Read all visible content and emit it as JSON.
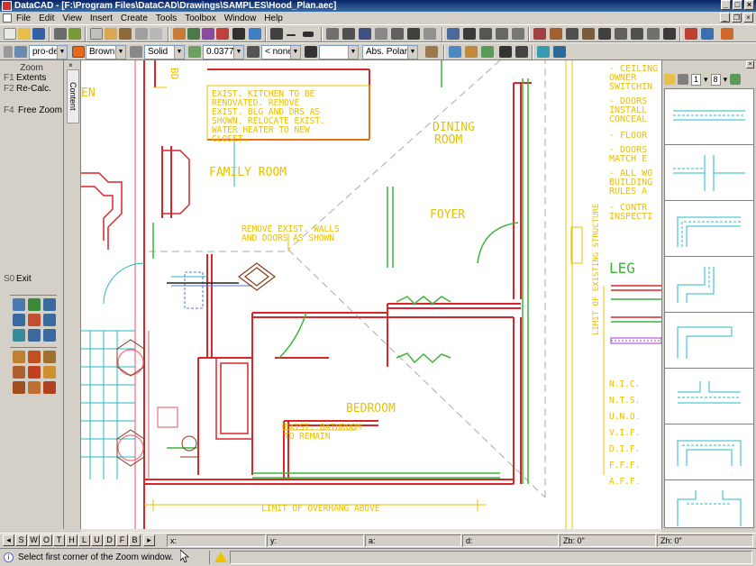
{
  "window": {
    "title": "DataCAD - [F:\\Program Files\\DataCAD\\Drawings\\SAMPLES\\Hood_Plan.aec]"
  },
  "menu": [
    "File",
    "Edit",
    "View",
    "Insert",
    "Create",
    "Tools",
    "Toolbox",
    "Window",
    "Help"
  ],
  "toolbar2": {
    "layer": "pro-dek",
    "color": "Brown",
    "linetype": "Solid",
    "line_weight": "0.037772",
    "none_combo": "< none >",
    "angle_mode": "Abs. Polar"
  },
  "left_menu": {
    "title": "Zoom",
    "items": [
      {
        "key": "F1",
        "label": "Extents"
      },
      {
        "key": "F2",
        "label": "Re-Calc."
      },
      {
        "key": "F4",
        "label": "Free Zoom"
      }
    ],
    "exit": {
      "key": "S0",
      "label": "Exit"
    }
  },
  "side_tab": {
    "label": "Content"
  },
  "drawing": {
    "notes": {
      "kitchen": [
        "EXIST. KITCHEN TO BE",
        "RENOVATED.  REMOVE",
        "EXIST. BLG AND DRS AS",
        "SHOWN.  RELOCATE EXIST.",
        "WATER HEATER TO NEW",
        "CLOSET."
      ],
      "walls": [
        "REMOVE EXIST. WALLS",
        "AND DOORS AS SHOWN"
      ],
      "bath": [
        "EXIST. BATHROOM",
        "TO REMAIN"
      ],
      "overhang": "LIMIT OF OVERHANG ABOVE",
      "structure": "LIMIT OF EXISTING STRUCTURE",
      "right_notes": [
        "- CEILING",
        "OWNER",
        "SWITCHIN",
        "- DOORS",
        "INSTALL",
        "CONCEAL",
        "- FLOOR",
        "- DOORS",
        "MATCH E",
        "- ALL WO",
        "BUILDING",
        "RULES A",
        "- CONTR",
        "INSPECTI"
      ],
      "legend": "LEG",
      "abbrev": [
        "N.I.C.",
        "N.T.S.",
        "U.N.O.",
        "V.I.F.",
        "D.I.F.",
        "F.F.F.",
        "A.F.F."
      ]
    },
    "rooms": {
      "family": "FAMILY ROOM",
      "dining": [
        "DINING",
        "ROOM"
      ],
      "foyer": "FOYER",
      "bedroom": "BEDROOM",
      "partial": "EN"
    }
  },
  "right_panel": {
    "page": "1",
    "page_of": "8"
  },
  "bottom_tabs": [
    "S",
    "W",
    "O",
    "T",
    "H",
    "L",
    "U",
    "D",
    "F",
    "B"
  ],
  "coords": {
    "x": "x:",
    "y": "y:",
    "a": "a:",
    "d": "d:",
    "zb": "Zb: 0\"",
    "zh": "Zh: 0\""
  },
  "status_message": "Select first corner of the Zoom window.",
  "colors": {
    "cad_yellow": "#e8c000",
    "cad_red": "#d8262a",
    "cad_green": "#3bb43b",
    "cad_cyan": "#25b8c8",
    "title_blue": "#0a246a"
  }
}
